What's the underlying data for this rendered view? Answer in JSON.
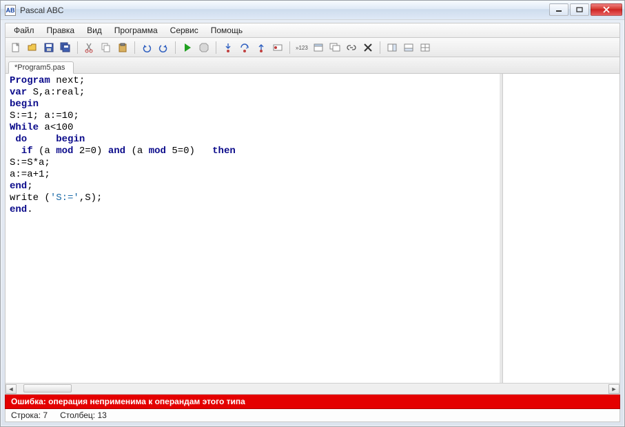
{
  "window": {
    "title": "Pascal ABC",
    "app_icon_text": "AB"
  },
  "menu": {
    "file": "Файл",
    "edit": "Правка",
    "view": "Вид",
    "program": "Программа",
    "service": "Сервис",
    "help": "Помощь"
  },
  "tab": {
    "label": "*Program5.pas"
  },
  "code": {
    "l1_kw": "Program",
    "l1_rest": " next;",
    "l2_kw": "var",
    "l2_rest": " S,a:real;",
    "l3_kw": "begin",
    "l4": "S:=1; a:=10;",
    "l5_kw": "While",
    "l5_rest": " a<100",
    "l6_do": " do",
    "l6_sp": "     ",
    "l6_begin": "begin",
    "l7_pre": "  ",
    "l7_if": "if",
    "l7_a": " (a ",
    "l7_mod1": "mod",
    "l7_b": " 2=0) ",
    "l7_and": "and",
    "l7_c": " (a ",
    "l7_mod2": "mod",
    "l7_d": " 5=0)   ",
    "l7_then": "then",
    "l8": "S:=S*a;",
    "l9": "a:=a+1;",
    "l10_kw": "end",
    "l10_rest": ";",
    "l11_a": "write (",
    "l11_str": "'S:='",
    "l11_b": ",S);",
    "l12_kw": "end",
    "l12_rest": "."
  },
  "error": {
    "text": "Ошибка: операция неприменима к операндам этого типа"
  },
  "status": {
    "line_label": "Строка:",
    "line_value": "7",
    "col_label": "Столбец:",
    "col_value": "13"
  }
}
